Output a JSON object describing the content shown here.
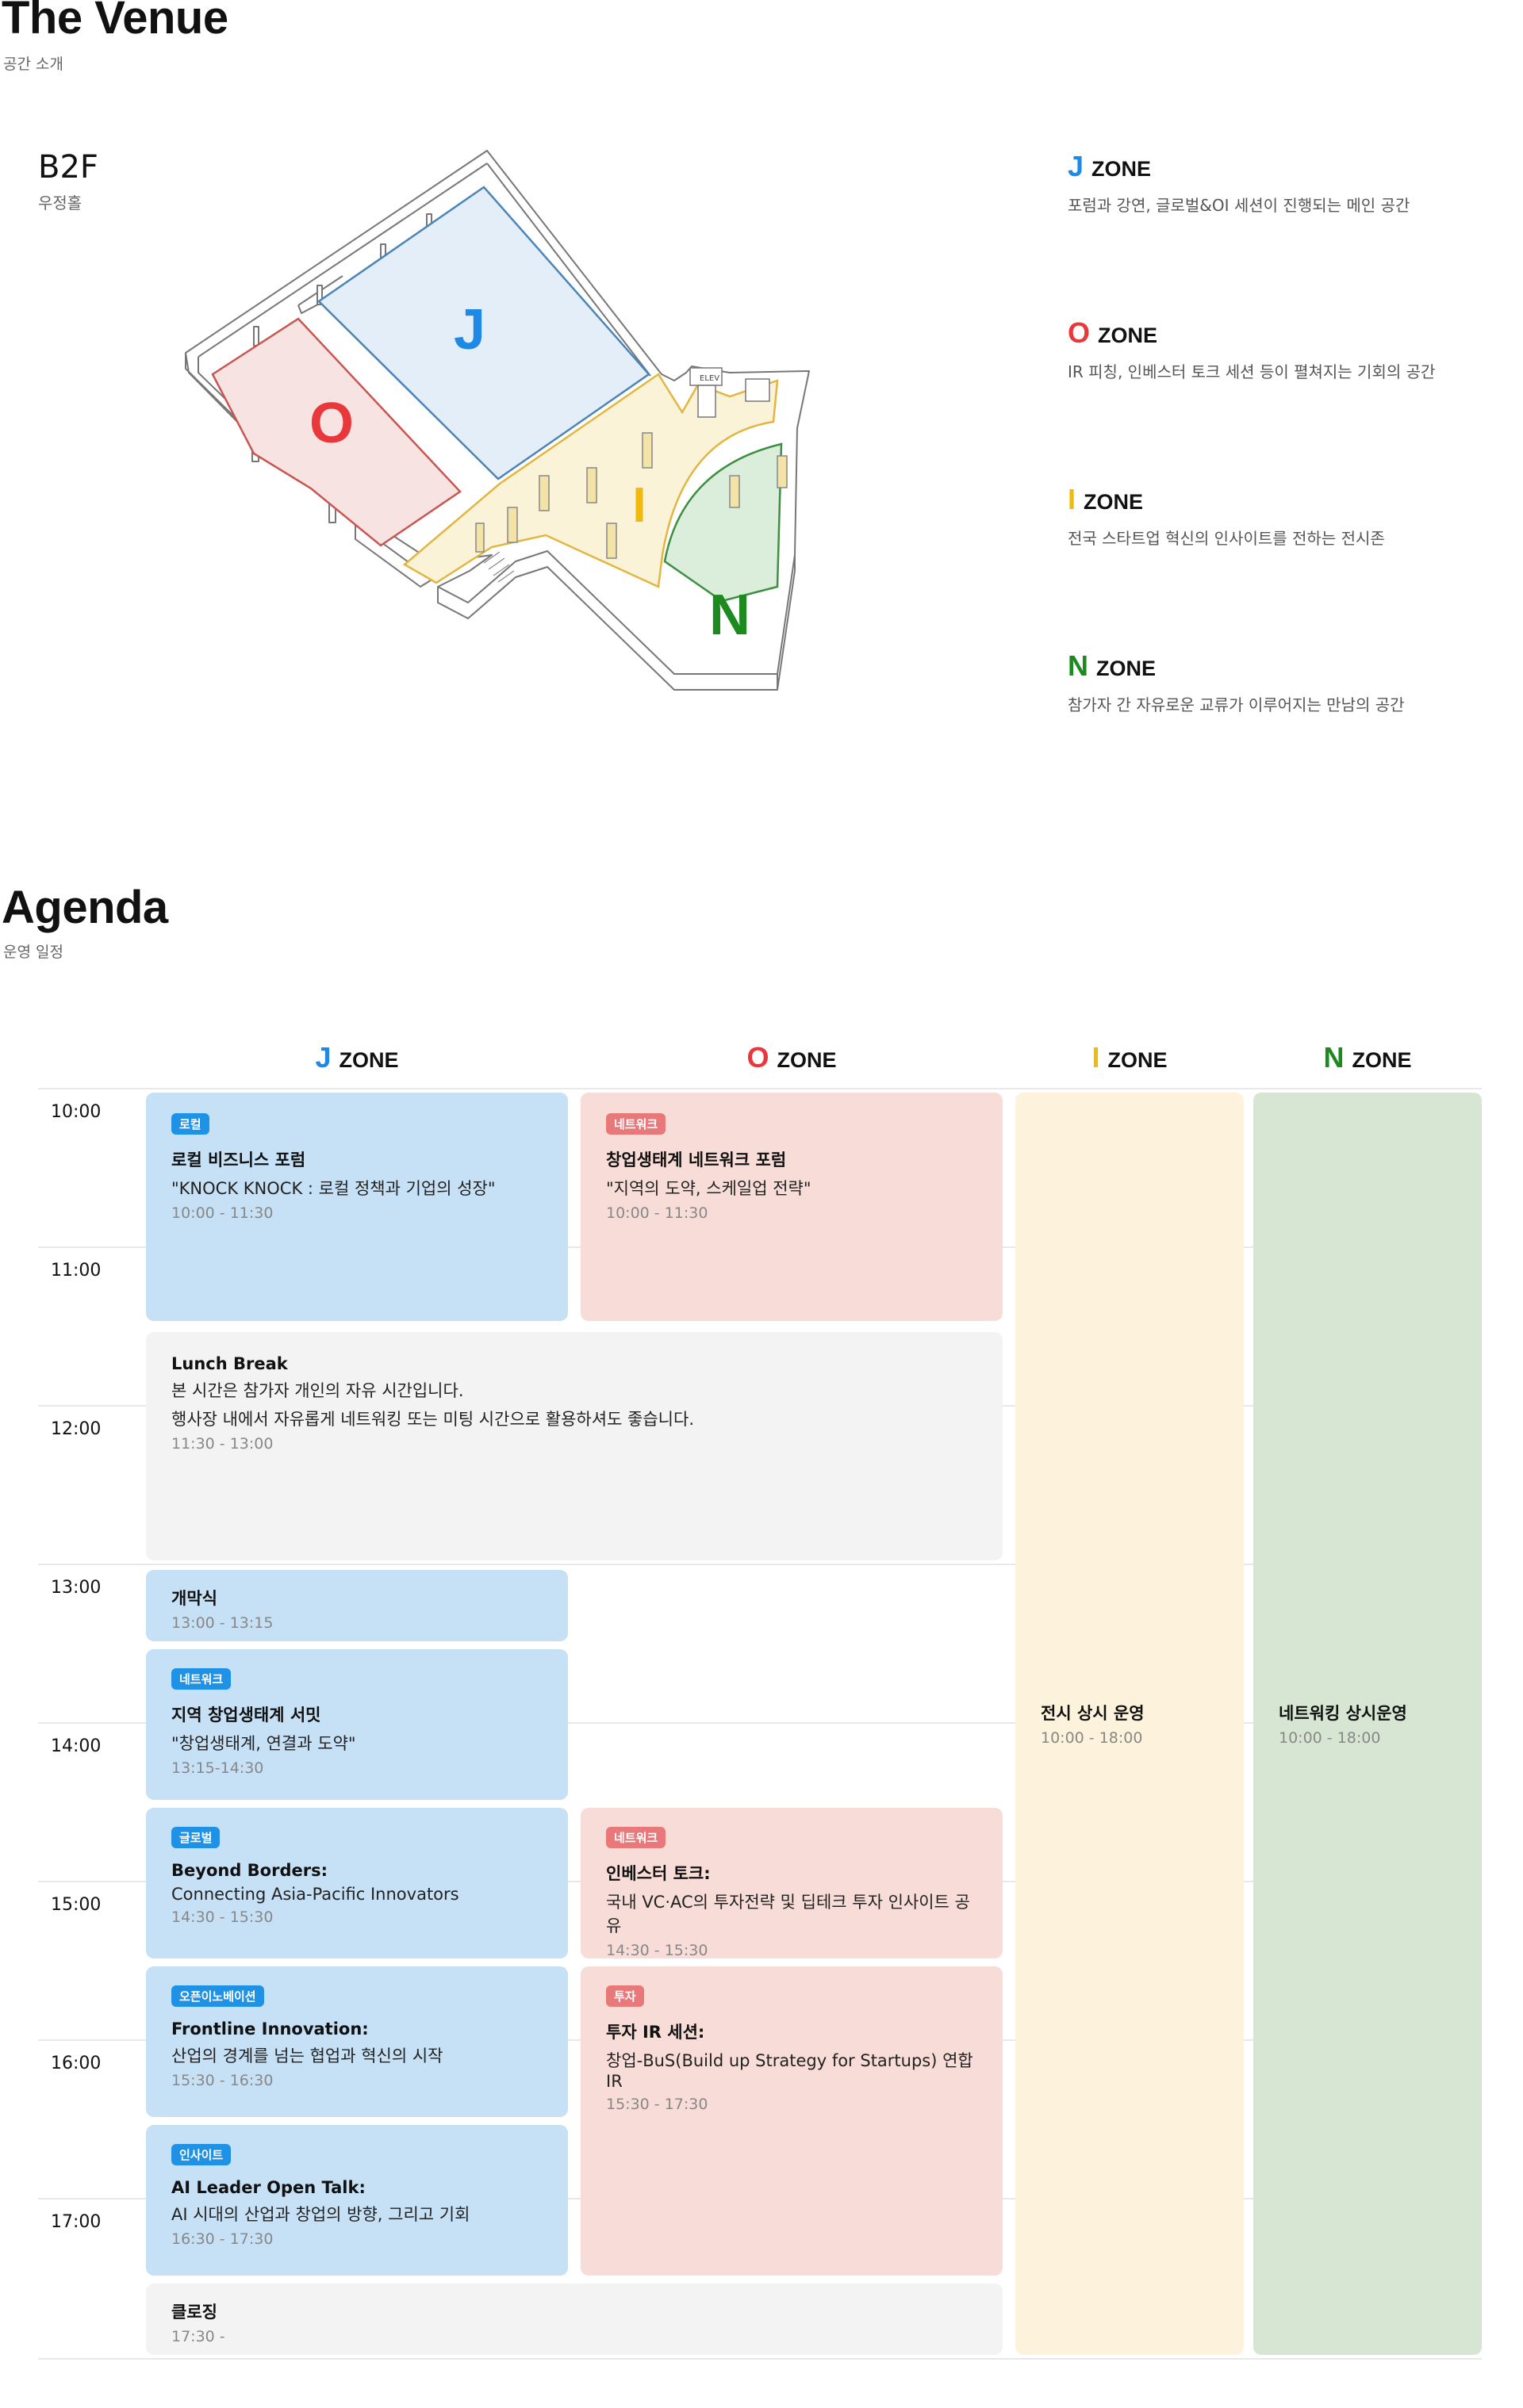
{
  "venue": {
    "title": "The Venue",
    "subtitle": "공간 소개",
    "floor": "B2F",
    "floor_name": "우정홀",
    "map_labels": {
      "j": "J",
      "o": "O",
      "i": "I",
      "n": "N",
      "elev": "ELEV"
    },
    "zones": [
      {
        "letter": "J",
        "word": "ZONE",
        "color": "#1f8ae6",
        "desc": "포럼과 강연, 글로벌&OI 세션이 진행되는 메인 공간"
      },
      {
        "letter": "O",
        "word": "ZONE",
        "color": "#e8383b",
        "desc": "IR 피칭, 인베스터 토크 세션 등이 펼쳐지는 기회의 공간"
      },
      {
        "letter": "I",
        "word": "ZONE",
        "color": "#f0b90e",
        "desc": "전국 스타트업 혁신의 인사이트를 전하는 전시존"
      },
      {
        "letter": "N",
        "word": "ZONE",
        "color": "#1d8a1f",
        "desc": "참가자 간 자유로운 교류가 이루어지는 만남의 공간"
      }
    ]
  },
  "agenda": {
    "title": "Agenda",
    "subtitle": "운영 일정",
    "columns": [
      {
        "letter": "J",
        "word": "ZONE",
        "color": "#1f8ae6"
      },
      {
        "letter": "O",
        "word": "ZONE",
        "color": "#e8383b"
      },
      {
        "letter": "I",
        "word": "ZONE",
        "color": "#f0b90e"
      },
      {
        "letter": "N",
        "word": "ZONE",
        "color": "#1d8a1f"
      }
    ],
    "times": [
      "10:00",
      "11:00",
      "12:00",
      "13:00",
      "14:00",
      "15:00",
      "16:00",
      "17:00"
    ],
    "sessions": {
      "local_forum": {
        "tag": "로컬",
        "title": "로컬 비즈니스 포럼",
        "sub": "\"KNOCK KNOCK : 로컬 정책과 기업의 성장\"",
        "time": "10:00 - 11:30"
      },
      "network_forum": {
        "tag": "네트워크",
        "title": "창업생태계 네트워크 포럼",
        "sub": "\"지역의 도약, 스케일업 전략\"",
        "time": "10:00 - 11:30"
      },
      "lunch": {
        "title": "Lunch Break",
        "line1": "본 시간은 참가자 개인의 자유 시간입니다.",
        "line2": "행사장 내에서 자유롭게 네트워킹 또는 미팅 시간으로 활용하셔도 좋습니다.",
        "time": "11:30 - 13:00"
      },
      "opening": {
        "title": "개막식",
        "time": "13:00 - 13:15"
      },
      "summit": {
        "tag": "네트워크",
        "title": "지역 창업생태계 서밋",
        "sub": "\"창업생태계, 연결과 도약\"",
        "time": "13:15-14:30"
      },
      "beyond": {
        "tag": "글로벌",
        "title": "Beyond Borders:",
        "sub": "Connecting Asia-Pacific Innovators",
        "time": "14:30 - 15:30"
      },
      "investor_talk": {
        "tag": "네트워크",
        "title": "인베스터 토크:",
        "sub": "국내 VC·AC의 투자전략 및 딥테크 투자 인사이트 공유",
        "time": "14:30 - 15:30"
      },
      "frontline": {
        "tag": "오픈이노베이션",
        "title": "Frontline Innovation:",
        "sub": "산업의 경계를 넘는 협업과 혁신의 시작",
        "time": "15:30 - 16:30"
      },
      "ir_session": {
        "tag": "투자",
        "title": "투자 IR 세션:",
        "sub": "창업-BuS(Build up Strategy for Startups) 연합 IR",
        "time": "15:30 - 17:30"
      },
      "ai_talk": {
        "tag": "인사이트",
        "title": "AI Leader Open Talk:",
        "sub": "AI 시대의 산업과 창업의 방향, 그리고 기회",
        "time": "16:30 - 17:30"
      },
      "closing": {
        "title": "클로징",
        "time": "17:30 -"
      },
      "exhibit": {
        "title": "전시 상시 운영",
        "time": "10:00 - 18:00"
      },
      "networking": {
        "title": "네트워킹 상시운영",
        "time": "10:00 - 18:00"
      }
    }
  }
}
